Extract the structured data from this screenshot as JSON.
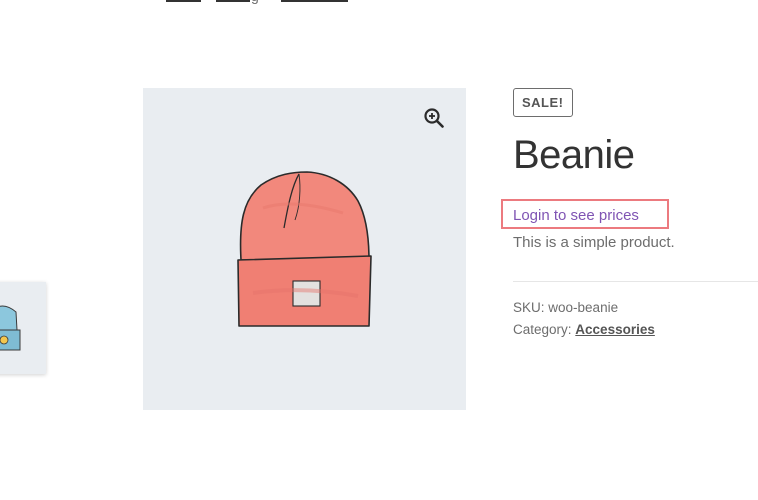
{
  "breadcrumb": {
    "fragment": "g"
  },
  "product": {
    "sale_badge": "SALE!",
    "title": "Beanie",
    "login_link": "Login to see prices",
    "description": "This is a simple product.",
    "sku_label": "SKU:",
    "sku_value": "woo-beanie",
    "category_label": "Category:",
    "category_value": "Accessories"
  },
  "icons": {
    "zoom": "zoom-in-icon"
  },
  "colors": {
    "login_link": "#7f54b3",
    "highlight_box": "#ec7a7f",
    "image_bg": "#e9edf1",
    "beanie": "#f2887c"
  }
}
